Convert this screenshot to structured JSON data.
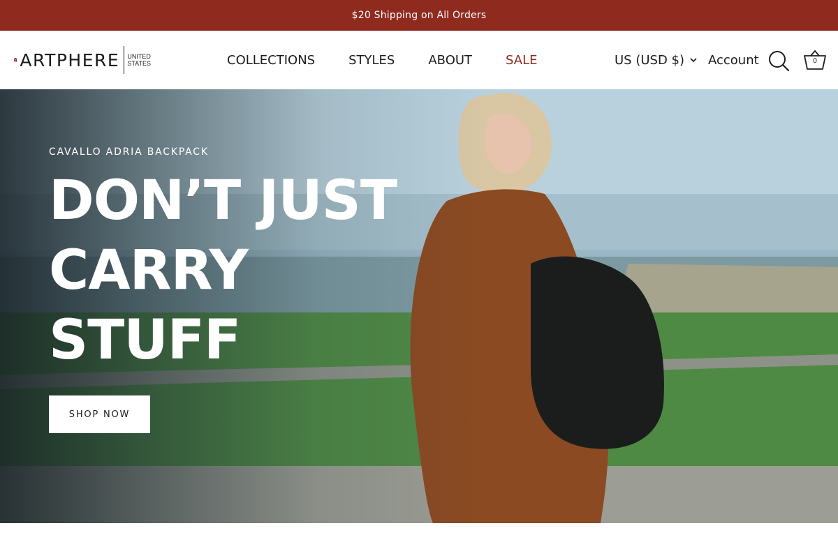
{
  "announcement": {
    "text": "$20 Shipping on All Orders"
  },
  "brand": {
    "name": "ARTPHERE",
    "region_line1": "UNITED",
    "region_line2": "STATES",
    "accent_color": "#8f2a1f"
  },
  "nav": {
    "items": [
      {
        "label": "COLLECTIONS"
      },
      {
        "label": "STYLES"
      },
      {
        "label": "ABOUT"
      },
      {
        "label": "SALE"
      }
    ]
  },
  "header_actions": {
    "currency": "US (USD $)",
    "account": "Account",
    "cart_count": "0",
    "icons": [
      "chevron-down-icon",
      "search-icon",
      "basket-icon"
    ]
  },
  "hero": {
    "subtitle": "CAVALLO ADRIA BACKPACK",
    "title_lines": [
      "DON’T JUST",
      "CARRY",
      "STUFF"
    ],
    "cta_label": "SHOP NOW"
  }
}
